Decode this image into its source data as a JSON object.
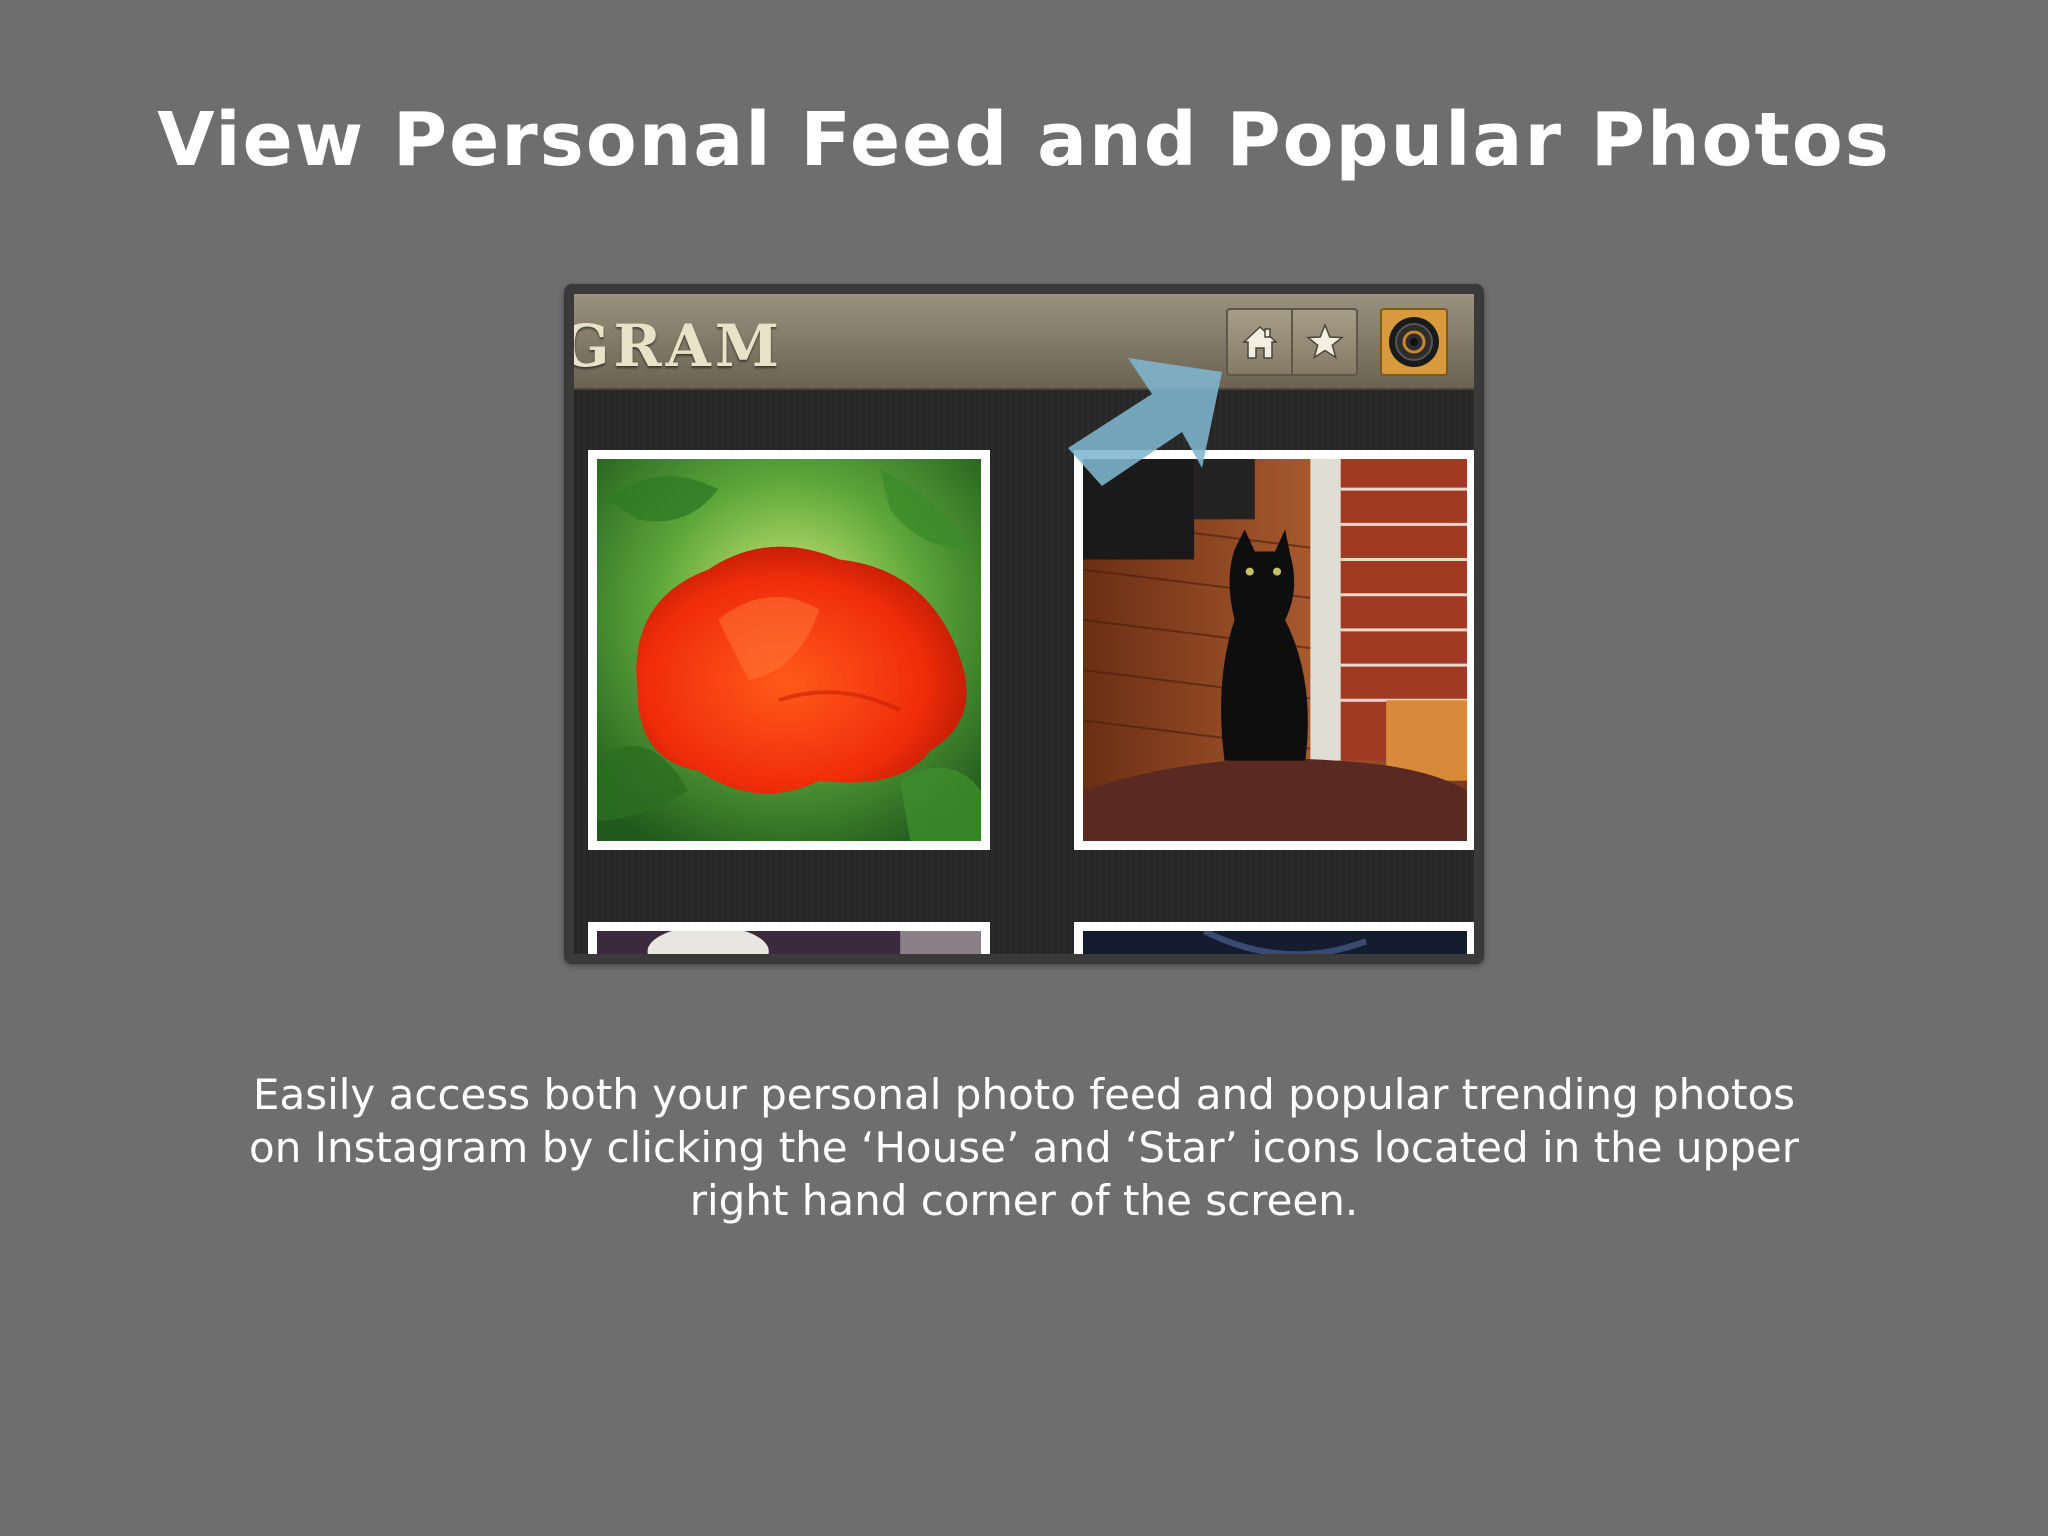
{
  "headline": "View Personal Feed and Popular Photos",
  "app": {
    "brand_text": "GRAM",
    "buttons": [
      {
        "name": "house",
        "icon": "home-icon"
      },
      {
        "name": "star",
        "icon": "star-icon"
      }
    ],
    "profile_icon": "camera-lens-icon"
  },
  "photos": [
    {
      "subject": "red poppy flower"
    },
    {
      "subject": "black cat on sofa"
    },
    {
      "subject": "photo partially visible"
    },
    {
      "subject": "photo partially visible"
    }
  ],
  "pointer": {
    "icon": "arrow-icon",
    "color": "#7fb6cf"
  },
  "caption": "Easily access both your personal photo feed and popular trending photos on Instagram by clicking the ‘House’ and ‘Star’ icons located in the upper right hand corner of the screen.",
  "colors": {
    "background": "#6e6e6e",
    "topbar": "#857c6a",
    "profile_button": "#d89a3c",
    "arrow": "#7fb6cf"
  }
}
